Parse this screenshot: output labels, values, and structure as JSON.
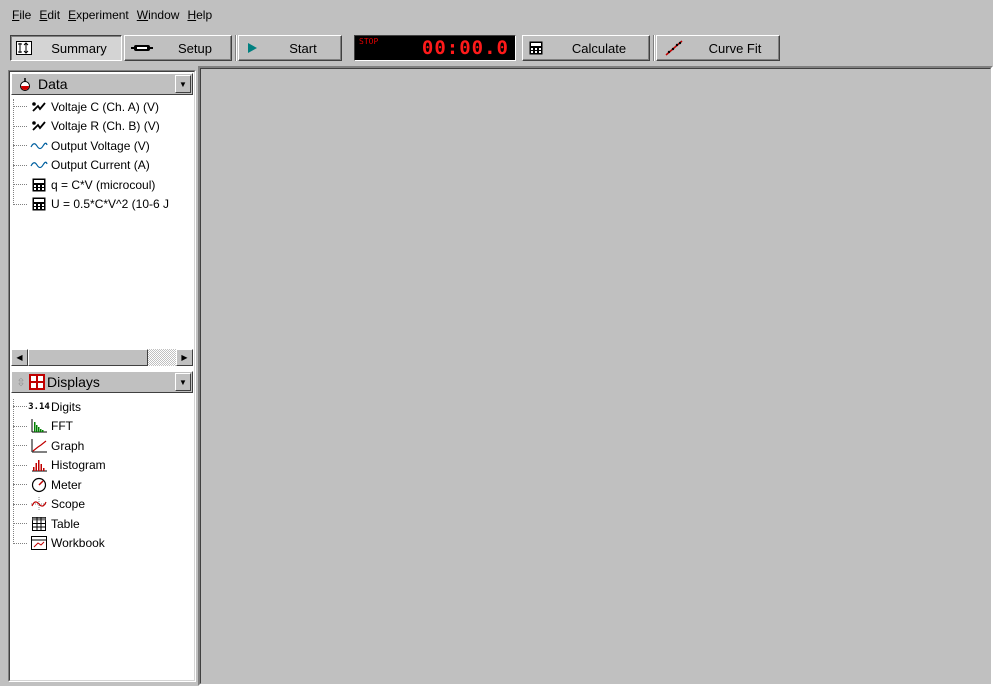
{
  "menu": [
    {
      "label": "File",
      "mnemonic": "F",
      "rest": "ile"
    },
    {
      "label": "Edit",
      "mnemonic": "E",
      "rest": "dit"
    },
    {
      "label": "Experiment",
      "mnemonic": "E",
      "rest": "xperiment"
    },
    {
      "label": "Window",
      "mnemonic": "W",
      "rest": "indow"
    },
    {
      "label": "Help",
      "mnemonic": "H",
      "rest": "elp"
    }
  ],
  "toolbar": {
    "summary_label": "Summary",
    "setup_label": "Setup",
    "start_label": "Start",
    "stop_text": "STOP",
    "timer_value": "00:00.0",
    "calculate_label": "Calculate",
    "curvefit_label": "Curve Fit"
  },
  "data_panel": {
    "title": "Data",
    "items": [
      {
        "label": "Voltaje C  (Ch. A) (V)",
        "icon": "sensor-probe-icon"
      },
      {
        "label": "Voltaje R (Ch. B) (V)",
        "icon": "sensor-probe-icon"
      },
      {
        "label": "Output Voltage (V)",
        "icon": "sine-wave-icon"
      },
      {
        "label": "Output Current (A)",
        "icon": "sine-wave-icon"
      },
      {
        "label": "q = C*V (microcoul)",
        "icon": "calculator-icon"
      },
      {
        "label": "U = 0.5*C*V^2 (10-6 J",
        "icon": "calculator-icon"
      }
    ]
  },
  "displays_panel": {
    "title": "Displays",
    "items": [
      {
        "label": "Digits",
        "icon": "digits-icon",
        "icon_text": "3.14"
      },
      {
        "label": "FFT",
        "icon": "fft-icon"
      },
      {
        "label": "Graph",
        "icon": "graph-icon"
      },
      {
        "label": "Histogram",
        "icon": "histogram-icon"
      },
      {
        "label": "Meter",
        "icon": "meter-icon"
      },
      {
        "label": "Scope",
        "icon": "scope-icon"
      },
      {
        "label": "Table",
        "icon": "table-icon"
      },
      {
        "label": "Workbook",
        "icon": "workbook-icon"
      }
    ]
  },
  "colors": {
    "timer_red": "#ff1a1a",
    "start_green": "#008080",
    "face": "#c0c0c0"
  }
}
